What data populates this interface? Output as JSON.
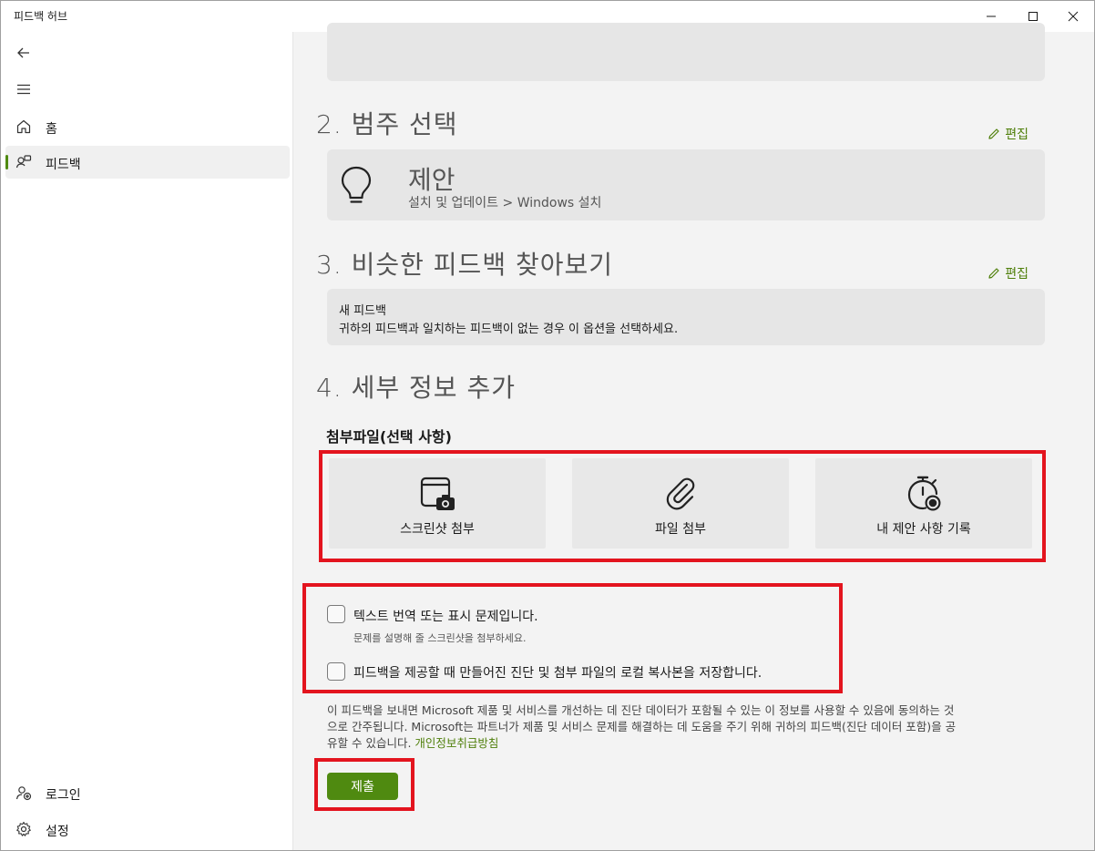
{
  "window": {
    "title": "피드백 허브"
  },
  "sidebar": {
    "items": [
      {
        "label": "홈"
      },
      {
        "label": "피드백"
      }
    ],
    "bottom": [
      {
        "label": "로그인"
      },
      {
        "label": "설정"
      }
    ]
  },
  "section2": {
    "title": "2. 범주 선택",
    "edit_label": "편집",
    "category": "제안",
    "path": "설치 및 업데이트 > Windows 설치"
  },
  "section3": {
    "title": "3. 비슷한 피드백 찾아보기",
    "edit_label": "편집",
    "selected_title": "새 피드백",
    "selected_desc": "귀하의 피드백과 일치하는 피드백이 없는 경우 이 옵션을 선택하세요."
  },
  "section4": {
    "title": "4. 세부 정보 추가",
    "attachments_heading": "첨부파일(선택 사항)",
    "attachments": [
      {
        "label": "스크린샷 첨부",
        "icon": "screenshot-icon"
      },
      {
        "label": "파일 첨부",
        "icon": "paperclip-icon"
      },
      {
        "label": "내 제안 사항 기록",
        "icon": "record-icon"
      }
    ],
    "checkbox1_label": "텍스트 번역 또는 표시 문제입니다.",
    "checkbox1_hint": "문제를 설명해 줄 스크린샷을 첨부하세요.",
    "checkbox1_checked": false,
    "checkbox2_label": "피드백을 제공할 때 만들어진 진단 및 첨부 파일의 로컬 복사본을 저장합니다.",
    "checkbox2_checked": false,
    "consent_line1": "이 피드백을 보내면 Microsoft 제품 및 서비스를 개선하는 데 진단 데이터가 포함될 수 있는 이 정보를 사용할 수 있음에 동의하는 것",
    "consent_line2": "으로 간주됩니다. Microsoft는 파트너가 제품 및 서비스 문제를 해결하는 데 도움을 주기 위해 귀하의 피드백(진단 데이터 포함)을 공",
    "consent_line3": "유할 수 있습니다.",
    "privacy_link": "개인정보취급방침",
    "submit_label": "제출"
  },
  "colors": {
    "accent": "#4f8a10",
    "highlight": "#e3141e"
  }
}
